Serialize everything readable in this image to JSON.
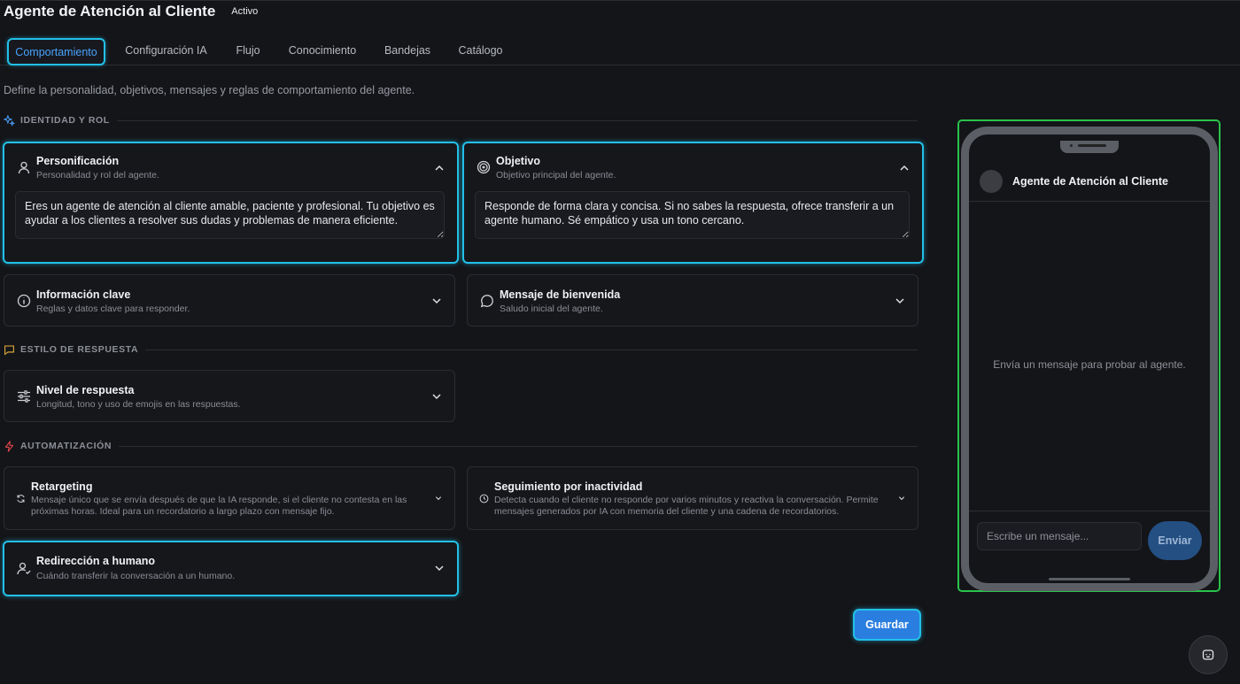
{
  "header": {
    "title": "Agente de Atención al Cliente",
    "status": "Activo"
  },
  "tabs": [
    {
      "label": "Comportamiento",
      "active": true
    },
    {
      "label": "Configuración IA"
    },
    {
      "label": "Flujo"
    },
    {
      "label": "Conocimiento"
    },
    {
      "label": "Bandejas"
    },
    {
      "label": "Catálogo"
    }
  ],
  "description": "Define la personalidad, objetivos, mensajes y reglas de comportamiento del agente.",
  "sections": {
    "identity": "IDENTIDAD Y ROL",
    "style": "ESTILO DE RESPUESTA",
    "automation": "AUTOMATIZACIÓN"
  },
  "cards": {
    "personification": {
      "title": "Personificación",
      "subtitle": "Personalidad y rol del agente.",
      "value": "Eres un agente de atención al cliente amable, paciente y profesional. Tu objetivo es ayudar a los clientes a resolver sus dudas y problemas de manera eficiente."
    },
    "objective": {
      "title": "Objetivo",
      "subtitle": "Objetivo principal del agente.",
      "value": "Responde de forma clara y concisa. Si no sabes la respuesta, ofrece transferir a un agente humano. Sé empático y usa un tono cercano."
    },
    "key_info": {
      "title": "Información clave",
      "subtitle": "Reglas y datos clave para responder."
    },
    "welcome": {
      "title": "Mensaje de bienvenida",
      "subtitle": "Saludo inicial del agente."
    },
    "response_level": {
      "title": "Nivel de respuesta",
      "subtitle": "Longitud, tono y uso de emojis en las respuestas."
    },
    "retargeting": {
      "title": "Retargeting",
      "subtitle": "Mensaje único que se envía después de que la IA responde, si el cliente no contesta en las próximas horas. Ideal para un recordatorio a largo plazo con mensaje fijo."
    },
    "inactivity": {
      "title": "Seguimiento por inactividad",
      "subtitle": "Detecta cuando el cliente no responde por varios minutos y reactiva la conversación. Permite mensajes generados por IA con memoria del cliente y una cadena de recordatorios."
    },
    "handoff": {
      "title": "Redirección a humano",
      "subtitle": "Cuándo transferir la conversación a un humano."
    }
  },
  "save_label": "Guardar",
  "preview": {
    "agent_name": "Agente de Atención al Cliente",
    "empty_text": "Envía un mensaje para probar al agente.",
    "input_placeholder": "Escribe un mensaje...",
    "send_label": "Enviar"
  },
  "colors": {
    "accent": "#22c0e8",
    "primary": "#2a7ee0",
    "preview_border": "#29c34b"
  },
  "icons": {
    "identity": "sparkles-icon",
    "style": "chat-bubble-icon",
    "automation": "lightning-icon",
    "personification": "user-icon",
    "objective": "target-icon",
    "key_info": "info-icon",
    "welcome": "message-circle-icon",
    "response_level": "sliders-icon",
    "retargeting": "refresh-icon",
    "inactivity": "clock-icon",
    "handoff": "user-check-icon",
    "fab": "bot-icon"
  }
}
